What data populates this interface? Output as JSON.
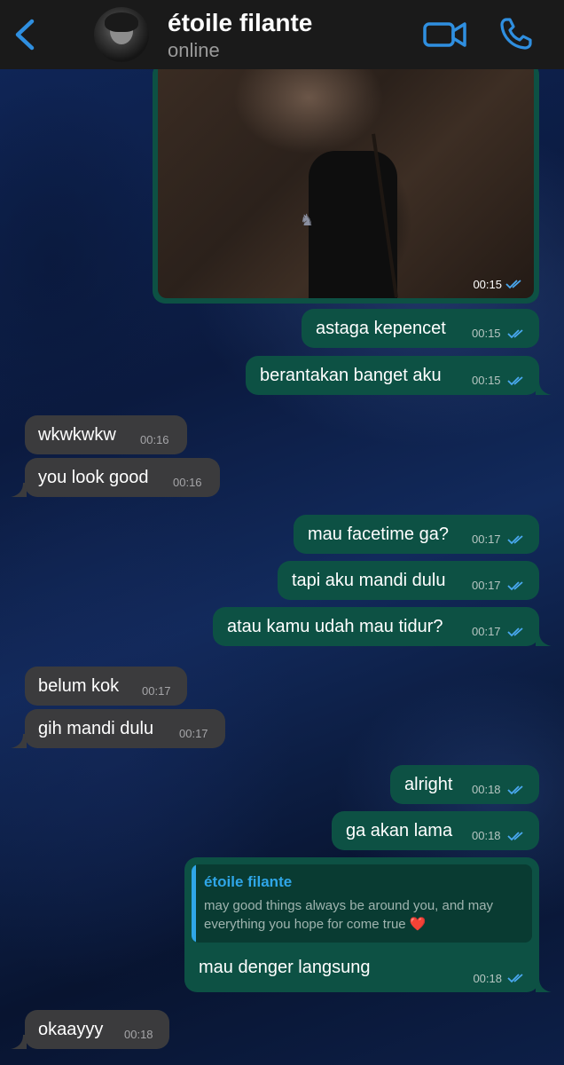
{
  "header": {
    "contact_name": "étoile filante",
    "status": "online"
  },
  "image_message": {
    "time": "00:15"
  },
  "messages": [
    {
      "text": "astaga kepencet",
      "time": "00:15"
    },
    {
      "text": "berantakan banget aku",
      "time": "00:15"
    },
    {
      "text": "wkwkwkw",
      "time": "00:16"
    },
    {
      "text": "you look good",
      "time": "00:16"
    },
    {
      "text": "mau facetime ga?",
      "time": "00:17"
    },
    {
      "text": "tapi aku mandi dulu",
      "time": "00:17"
    },
    {
      "text": "atau kamu udah mau tidur?",
      "time": "00:17"
    },
    {
      "text": "belum kok",
      "time": "00:17"
    },
    {
      "text": "gih mandi dulu",
      "time": "00:17"
    },
    {
      "text": "alright",
      "time": "00:18"
    },
    {
      "text": "ga akan lama",
      "time": "00:18"
    },
    {
      "text": "okaayyy",
      "time": "00:18"
    }
  ],
  "reply_message": {
    "quoted_author": "étoile filante",
    "quoted_text": "may good things always be around you, and may everything you hope for come true",
    "quoted_emoji": "❤️",
    "text": "mau denger langsung",
    "time": "00:18"
  },
  "colors": {
    "header_bg": "#1a1a1a",
    "outgoing_bubble": "#0d5144",
    "incoming_bubble": "#3b3b3d",
    "accent_blue": "#2f8fe0",
    "read_ticks": "#4aa8f0"
  },
  "icons": {
    "back": "chevron-left-icon",
    "video": "video-camera-icon",
    "call": "phone-icon",
    "read": "double-check-icon"
  }
}
